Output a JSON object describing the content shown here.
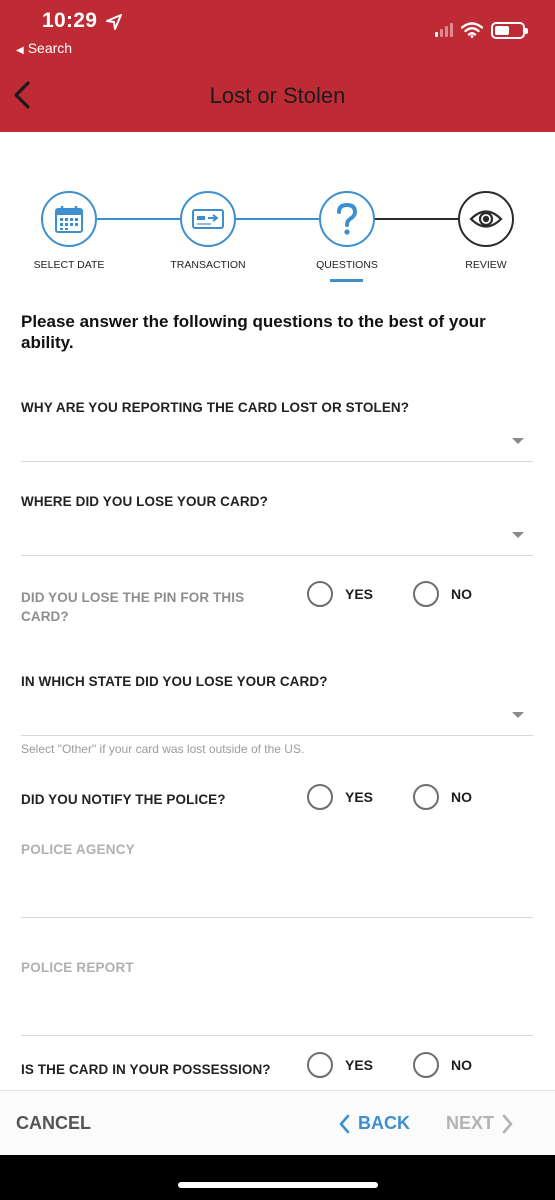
{
  "status_bar": {
    "time": "10:29",
    "back_app": "Search",
    "icons": [
      "location-arrow-icon",
      "signal-icon",
      "wifi-icon",
      "battery-icon"
    ]
  },
  "header": {
    "title": "Lost or Stolen",
    "back_icon": "chevron-left-icon",
    "background": "#bf2b34"
  },
  "stepper": {
    "accent": "#3d8fd0",
    "steps": [
      {
        "label": "SELECT DATE",
        "icon": "calendar-icon",
        "state": "complete"
      },
      {
        "label": "TRANSACTION",
        "icon": "card-transfer-icon",
        "state": "complete"
      },
      {
        "label": "QUESTIONS",
        "icon": "question-icon",
        "state": "active"
      },
      {
        "label": "REVIEW",
        "icon": "eye-icon",
        "state": "pending"
      }
    ]
  },
  "form": {
    "intro": "Please answer the following questions to the best of your ability.",
    "q1": {
      "label": "WHY ARE YOU REPORTING THE CARD LOST OR STOLEN?",
      "value": ""
    },
    "q2": {
      "label": "WHERE DID YOU LOSE YOUR CARD?",
      "value": ""
    },
    "q3": {
      "label": "DID YOU LOSE THE PIN FOR THIS CARD?",
      "yes": "YES",
      "no": "NO"
    },
    "q4": {
      "label": "IN WHICH STATE DID YOU LOSE YOUR CARD?",
      "value": "",
      "helper": "Select \"Other\" if your card was lost outside of the US."
    },
    "q5": {
      "label": "DID YOU NOTIFY THE POLICE?",
      "yes": "YES",
      "no": "NO"
    },
    "police_agency": {
      "label": "POLICE AGENCY",
      "value": ""
    },
    "police_report": {
      "label": "POLICE REPORT",
      "value": ""
    },
    "q6": {
      "label": "IS THE CARD IN YOUR POSSESSION?",
      "yes": "YES",
      "no": "NO"
    }
  },
  "footer": {
    "cancel": "CANCEL",
    "back": "BACK",
    "next": "NEXT"
  }
}
